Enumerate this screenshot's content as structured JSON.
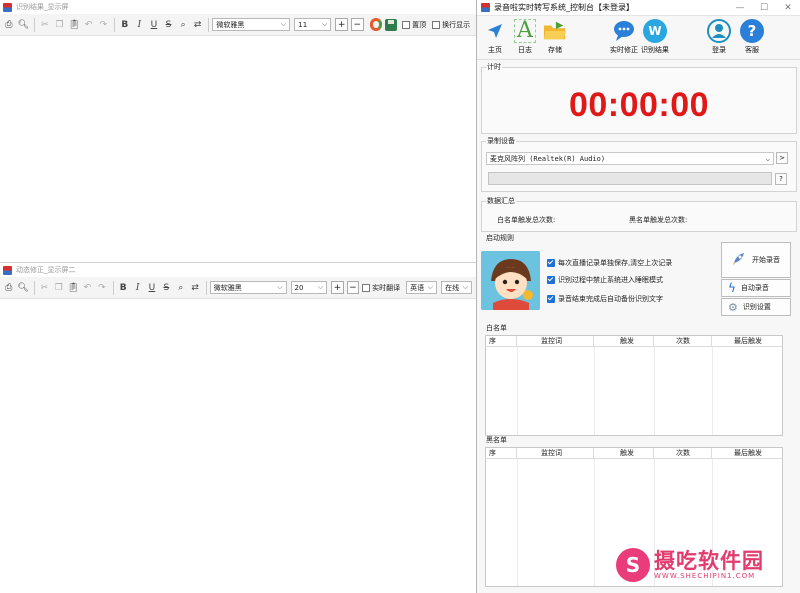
{
  "display1": {
    "title": "识别结果_显示屏",
    "font_family": "微软雅黑",
    "font_size": "11",
    "pin_label": "置顶",
    "wrap_label": "换行显示"
  },
  "display2": {
    "title": "动态修正_显示屏二",
    "font_family": "微软雅黑",
    "font_size": "20",
    "realtime_translate_label": "实时翻译",
    "language": "英语",
    "mode": "在线"
  },
  "toolbar": {
    "bold": "B",
    "italic": "I",
    "underline": "U",
    "strike": "S",
    "plus": "+",
    "minus": "−"
  },
  "panel": {
    "title": "录音啦实时转写系统_控制台【未登录】",
    "tools": {
      "home": "主页",
      "log": "日志",
      "store": "存储",
      "live_fix": "实时修正",
      "results": "识别结果",
      "login": "登录",
      "service": "客服"
    },
    "timer": {
      "legend": "计时",
      "value": "00:00:00"
    },
    "device": {
      "legend": "录制设备",
      "selected": "麦克风阵列 (Realtek(R) Audio)",
      "help": "?",
      "more": ">"
    },
    "stats": {
      "legend": "数据汇总",
      "whitelist_label": "白名单触发总次数:",
      "blacklist_label": "黑名单触发总次数:"
    },
    "rules": {
      "legend": "启动规则",
      "items": [
        "每次直播记录单独保存,清空上次记录",
        "识别过程中禁止系统进入睡眠模式",
        "录音结束完成后自动备份识别文字"
      ],
      "start_button": "开始录音",
      "auto_button": "自动录音",
      "settings_button": "识别设置"
    },
    "whitelist": {
      "legend": "白名单",
      "columns": [
        "序",
        "监控词",
        "触发",
        "次数",
        "最后触发"
      ]
    },
    "blacklist": {
      "legend": "黑名单",
      "columns": [
        "序",
        "监控词",
        "触发",
        "次数",
        "最后触发"
      ]
    }
  },
  "watermark": {
    "logo": "S",
    "name": "摄吃软件园",
    "url": "WWW.SHECHIPIN1.COM"
  },
  "colors": {
    "timer": "#e01818",
    "accent": "#1e6fd6",
    "watermark": "#e23b6e"
  }
}
